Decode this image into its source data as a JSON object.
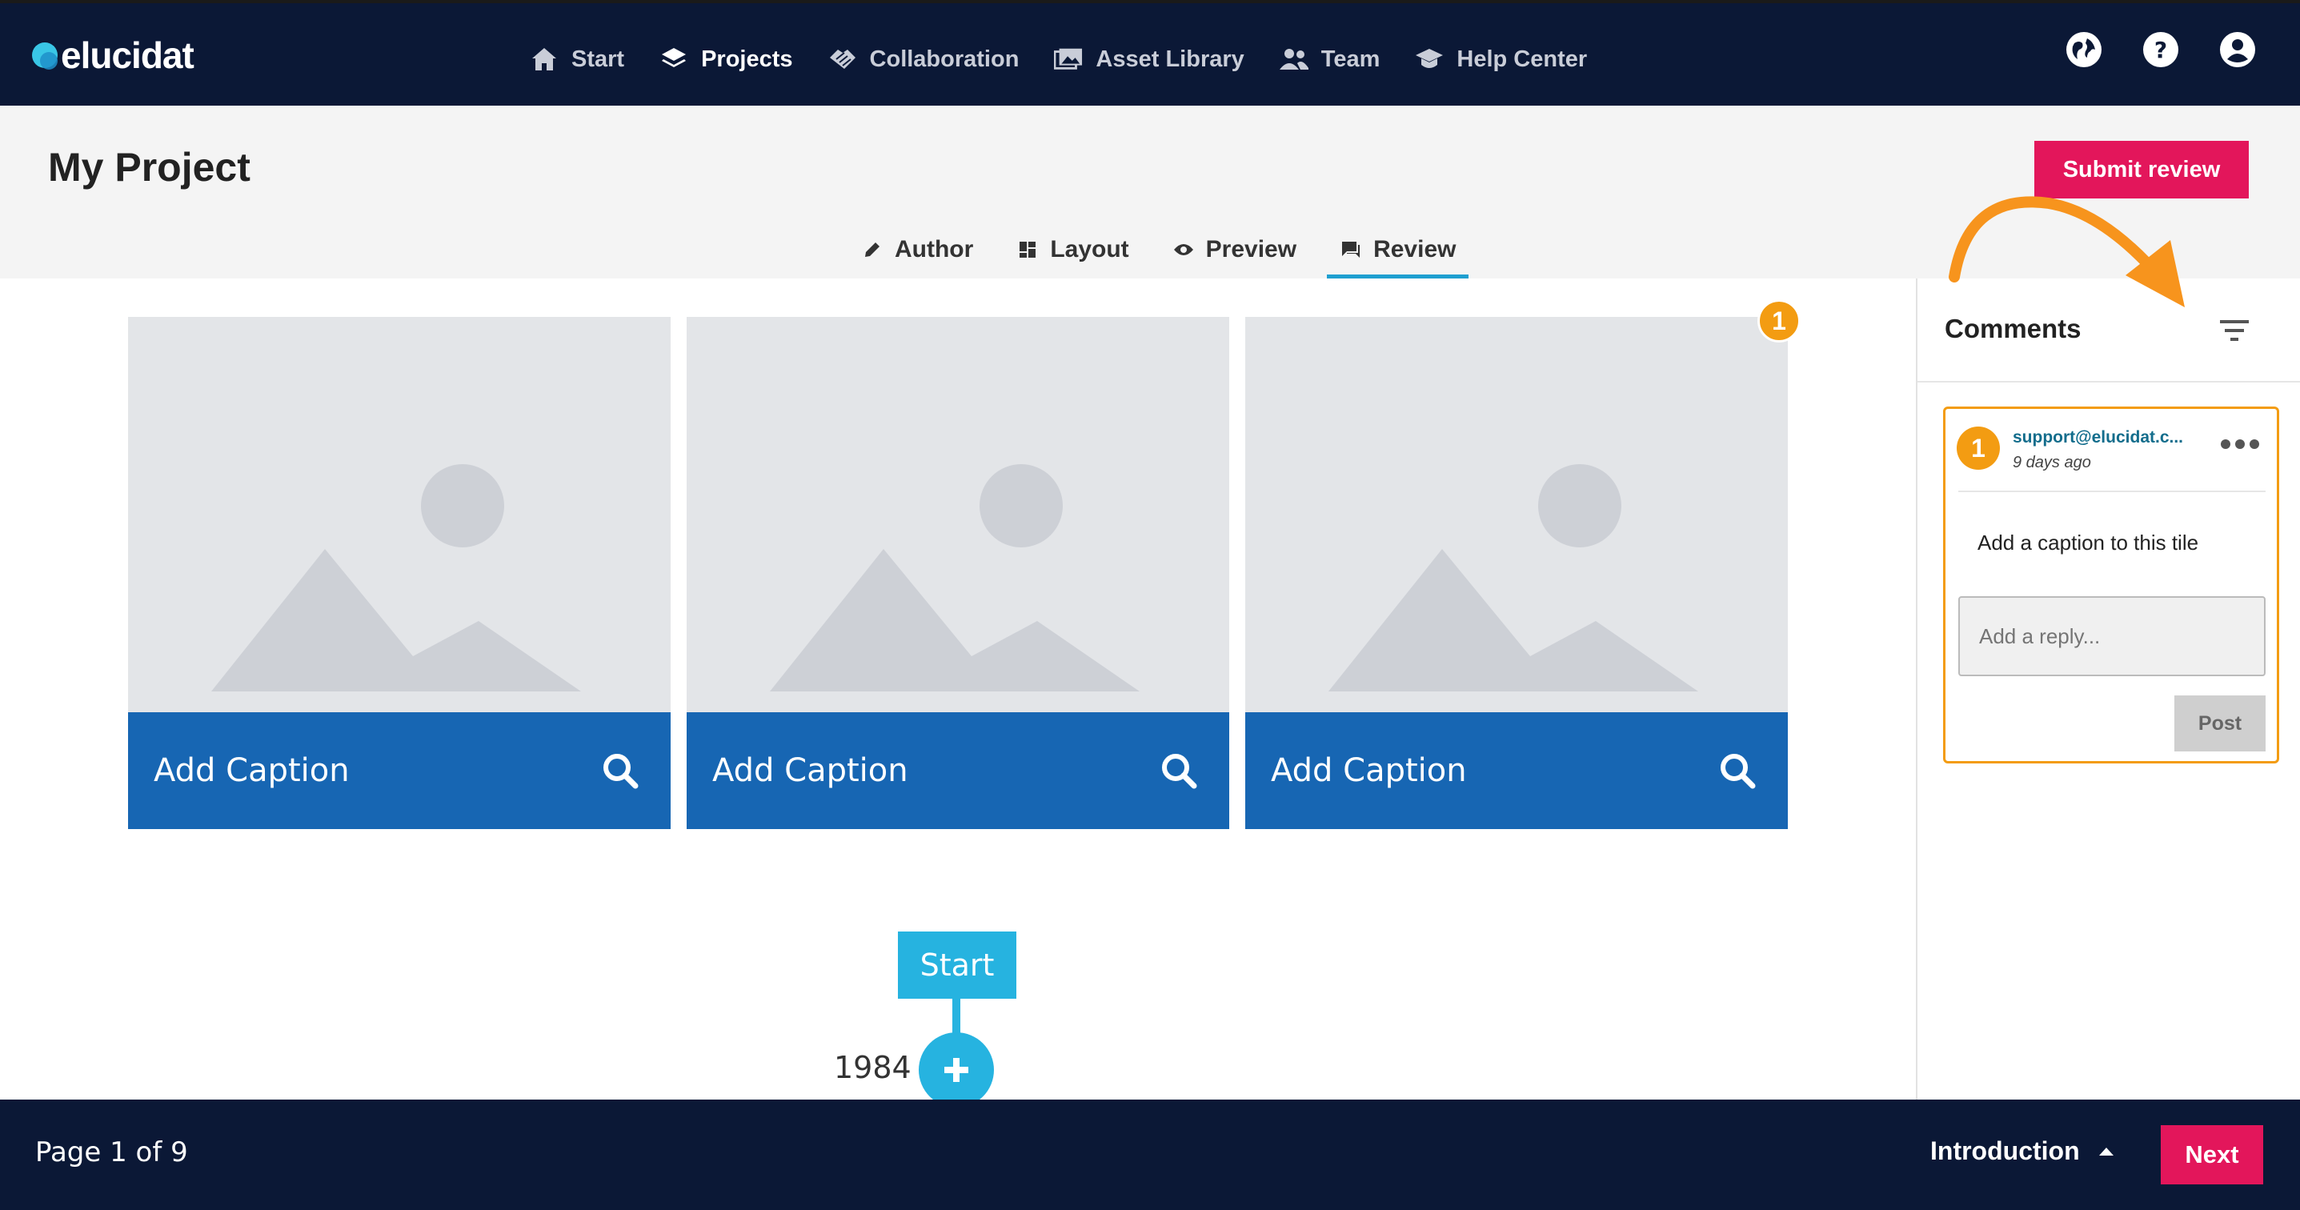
{
  "brand": {
    "name": "elucidat"
  },
  "nav": {
    "items": [
      {
        "label": "Start",
        "icon": "home-icon"
      },
      {
        "label": "Projects",
        "icon": "layers-icon",
        "active": true
      },
      {
        "label": "Collaboration",
        "icon": "handshake-icon"
      },
      {
        "label": "Asset Library",
        "icon": "images-icon"
      },
      {
        "label": "Team",
        "icon": "people-icon"
      },
      {
        "label": "Help Center",
        "icon": "graduation-cap-icon"
      }
    ],
    "right_icons": [
      "globe-icon",
      "help-icon",
      "account-icon"
    ]
  },
  "header": {
    "title": "My Project",
    "submit_label": "Submit review",
    "tabs": [
      {
        "label": "Author",
        "icon": "pencil-icon"
      },
      {
        "label": "Layout",
        "icon": "layout-icon"
      },
      {
        "label": "Preview",
        "icon": "eye-icon"
      },
      {
        "label": "Review",
        "icon": "comment-icon",
        "active": true
      }
    ]
  },
  "tiles": [
    {
      "caption": "Add Caption"
    },
    {
      "caption": "Add Caption"
    },
    {
      "caption": "Add Caption"
    }
  ],
  "tile_marker": "1",
  "timeline": {
    "start_label": "Start",
    "year": "1984"
  },
  "comments": {
    "title": "Comments",
    "items": [
      {
        "number": "1",
        "author": "support@elucidat.c...",
        "time": "9 days ago",
        "body": "Add a caption to this tile",
        "reply_placeholder": "Add a reply...",
        "post_label": "Post"
      }
    ]
  },
  "footer": {
    "page_indicator": "Page 1 of 9",
    "section": "Introduction",
    "next_label": "Next"
  },
  "colors": {
    "nav_bg": "#0b1836",
    "accent_pink": "#e3165b",
    "caption_blue": "#1766b3",
    "timeline_cyan": "#26b3e0",
    "marker_orange": "#f39c12"
  }
}
